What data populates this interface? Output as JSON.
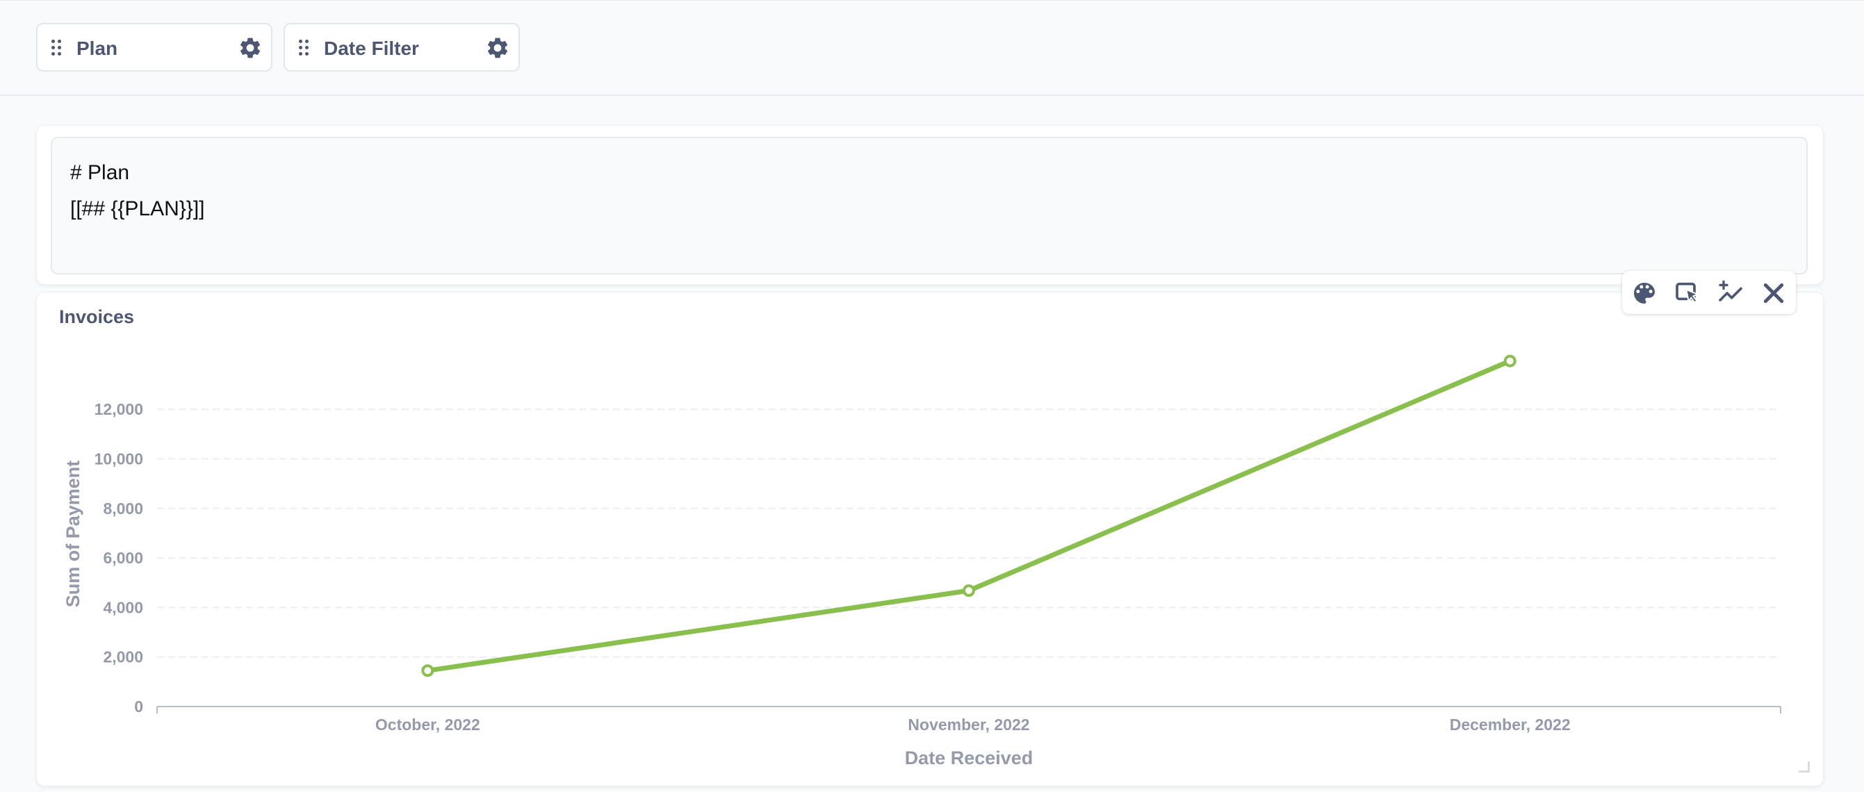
{
  "filters": [
    {
      "label": "Plan"
    },
    {
      "label": "Date Filter"
    }
  ],
  "text_card": {
    "lines": [
      "# Plan",
      "[[## {{PLAN}}]]"
    ]
  },
  "chart_card": {
    "title": "Invoices",
    "actions": [
      "palette-icon",
      "click-behavior-icon",
      "add-series-icon",
      "close-icon"
    ]
  },
  "colors": {
    "series": "#88bf4d",
    "axis_text": "#949aab",
    "label_text": "#4c5773",
    "grid": "#eceef1"
  },
  "chart_data": {
    "type": "line",
    "categories": [
      "October, 2022",
      "November, 2022",
      "December, 2022"
    ],
    "series": [
      {
        "values": [
          1450,
          4680,
          13950
        ]
      }
    ],
    "xlabel": "Date Received",
    "ylabel": "Sum of Payment",
    "yticks": [
      "0",
      "2,000",
      "4,000",
      "6,000",
      "8,000",
      "10,000",
      "12,000"
    ],
    "ylim": [
      0,
      14500
    ],
    "grid": "horizontal-dashed"
  }
}
